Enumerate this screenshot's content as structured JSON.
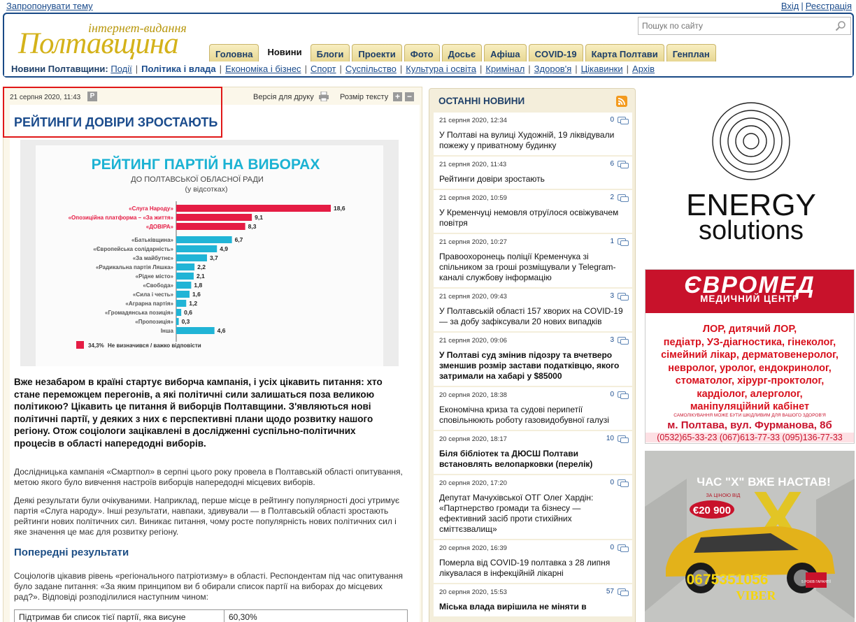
{
  "top": {
    "suggest": "Запропонувати тему",
    "login": "Вхід",
    "separator": "|",
    "register": "Реєстрація"
  },
  "logo": {
    "top": "інтернет-видання",
    "main": "Полтавщина"
  },
  "search": {
    "placeholder": "Пошук по сайту"
  },
  "tabs": [
    "Головна",
    "Новини",
    "Блоги",
    "Проекти",
    "Фото",
    "Досьє",
    "Афіша",
    "COVID-19",
    "Карта Полтави",
    "Генплан"
  ],
  "active_tab": "Новини",
  "subnav": {
    "label": "Новини Полтавщини:",
    "items": [
      "Події",
      "Політика і влада",
      "Економіка і бізнес",
      "Спорт",
      "Суспільство",
      "Культура і освіта",
      "Кримінал",
      "Здоров'я",
      "Цікавинки",
      "Архів"
    ],
    "bold_item": "Політика і влада"
  },
  "article": {
    "date": "21 серпня 2020, 11:43",
    "p_badge": "P",
    "print_label": "Версія для друку",
    "size_label": "Розмір тексту",
    "plus": "+",
    "minus": "−",
    "title": "РЕЙТИНГИ ДОВІРИ ЗРОСТАЮТЬ",
    "lead": "Вже незабаром в країні стартує виборча кампанія, і усіх цікавить питання: хто стане переможцем перегонів, а які політичні сили залишаться поза великою політикою? Цікавить це питання й виборців Полтавщини. З'являються нові політичні партії, у деяких з них є перспективні плани щодо розвитку нашого регіону. Отож соціологи зацікавлені в дослідженні суспільно-політичних процесів в області напередодні виборів.",
    "p1": "Дослідницька кампанія «Смартпол» в серпні цього року провела в Полтавській області опитування, метою якого було вивчення настроїв виборців напередодні місцевих виборів.",
    "p2": "Деякі результати були очікуваними. Наприклад, перше місце в рейтингу популярності досі утримує партія «Слуга народу». Інші результати, навпаки, здивували — в Полтавській області зростають рейтинги нових політичних сил. Виникає питання, чому росте популярність нових політичних сил і яке значення це має для розвитку регіону.",
    "subhead": "Попередні результати",
    "p3": "Соціологів цікавив рівень «регіонального патріотизму» в області. Респондентам під час опитування було задане питання: «За яким принципом ви б обирали список партії на виборах до місцевих рад?». Відповіді розподілилися наступним чином:",
    "table_row": {
      "label": "Підтримав би список тієї партії, яка висуне",
      "value": "60,30%"
    }
  },
  "chart_data": {
    "type": "bar",
    "title": "РЕЙТИНГ ПАРТІЙ НА ВИБОРАХ",
    "subtitle": "ДО ПОЛТАВСЬКОЇ ОБЛАСНОЇ РАДИ",
    "unit_label": "(у відсотках)",
    "categories": [
      "«Слуга Народу»",
      "«Опозиційна платформа – «За життя»",
      "«ДОВІРА»",
      "«Батьківщина»",
      "«Європейська солідарність»",
      "«За майбутнє»",
      "«Радикальна партія Ляшка»",
      "«Рідне місто»",
      "«Свобода»",
      "«Сила і честь»",
      "«Аграрна партія»",
      "«Громадянська позиція»",
      "«Пропозиція»",
      "Інша"
    ],
    "values": [
      18.6,
      9.1,
      8.3,
      6.7,
      4.9,
      3.7,
      2.2,
      2.1,
      1.8,
      1.6,
      1.2,
      0.6,
      0.3,
      4.6
    ],
    "value_labels": [
      "18,6",
      "9,1",
      "8,3",
      "6,7",
      "4,9",
      "3,7",
      "2,2",
      "2,1",
      "1,8",
      "1,6",
      "1,2",
      "0,6",
      "0,3",
      "4,6"
    ],
    "highlighted_count": 3,
    "colors": {
      "highlight": "#e51c44",
      "other": "#21b4d6"
    },
    "legend": {
      "value": "34,3%",
      "text": "Не визначився / важко відповісти",
      "color": "#e51c44"
    }
  },
  "news": {
    "header": "ОСТАННІ НОВИНИ",
    "items": [
      {
        "date": "21 серпня 2020, 12:34",
        "count": "0",
        "title": "У Полтаві на вулиці Художній, 19 ліквідували пожежу у приватному будинку",
        "bold": false
      },
      {
        "date": "21 серпня 2020, 11:43",
        "count": "6",
        "title": "Рейтинги довіри зростають",
        "bold": false
      },
      {
        "date": "21 серпня 2020, 10:59",
        "count": "2",
        "title": "У Кременчуці немовля отруїлося освіжувачем повітря",
        "bold": false
      },
      {
        "date": "21 серпня 2020, 10:27",
        "count": "1",
        "title": "Правоохоронець поліції Кременчука зі спільником за гроші розміщували у Telegram-каналі службову інформацію",
        "bold": false
      },
      {
        "date": "21 серпня 2020, 09:43",
        "count": "3",
        "title": "У Полтавській області 157 хворих на COVID-19 — за добу зафіксували 20 нових випадків",
        "bold": false
      },
      {
        "date": "21 серпня 2020, 09:06",
        "count": "3",
        "title": "У Полтаві суд змінив підозру та вчетверо зменшив розмір застави податківцю, якого затримали на хабарі у $85000",
        "bold": true
      },
      {
        "date": "20 серпня 2020, 18:38",
        "count": "0",
        "title": "Економічна криза та судові перипетії сповільнюють роботу газовидобувної галузі",
        "bold": false
      },
      {
        "date": "20 серпня 2020, 18:17",
        "count": "10",
        "title": "Біля бібліотек та ДЮСШ Полтави встановлять велопарковки (перелік)",
        "bold": true
      },
      {
        "date": "20 серпня 2020, 17:20",
        "count": "0",
        "title": "Депутат Мачухівської ОТГ Олег Хардін: «Партнерство громади та бізнесу — ефективний засіб проти стихійних сміттєзвалищ»",
        "bold": false
      },
      {
        "date": "20 серпня 2020, 16:39",
        "count": "0",
        "title": "Померла від COVID-19 полтавка з 28 липня лікувалася в інфекційній лікарні",
        "bold": false
      },
      {
        "date": "20 серпня 2020, 15:53",
        "count": "57",
        "title": "Міська влада вирішила не міняти в",
        "bold": true
      }
    ]
  },
  "ads": {
    "energy": {
      "line1": "ENERGY",
      "line2": "solutions"
    },
    "evromed": {
      "logo": "ЄВРОМЕД",
      "subtitle": "МЕДИЧНИЙ ЦЕНТР",
      "services": [
        "ЛОР, дитячий ЛОР,",
        "педіатр, УЗ-діагностика, гінеколог,",
        "сімейний лікар, дерматовенеролог,",
        "невролог, уролог, ендокринолог,",
        "стоматолог, хірург-проктолог,",
        "кардіолог, алерголог,",
        "маніпуляційний кабінет"
      ],
      "small": "САМОЛІКУВАННЯ МОЖЕ БУТИ ШКІДЛИВИМ ДЛЯ ВАШОГО ЗДОРОВ'Я",
      "address": "м. Полтава, вул. Фурманова, 8б",
      "phones": "(0532)65-33-23 (067)613-77-33 (095)136-77-33"
    },
    "kia": {
      "slogan": "ЧАС \"Х\" ВЖЕ НАСТАВ!",
      "price_label": "ЗА ЦІНОЮ ВІД",
      "price": "€20 900",
      "phone": "0675351056",
      "viber": "VIBER",
      "years_label": "5 РОКІВ ГАРАНТІЇ",
      "plate": "X"
    }
  }
}
